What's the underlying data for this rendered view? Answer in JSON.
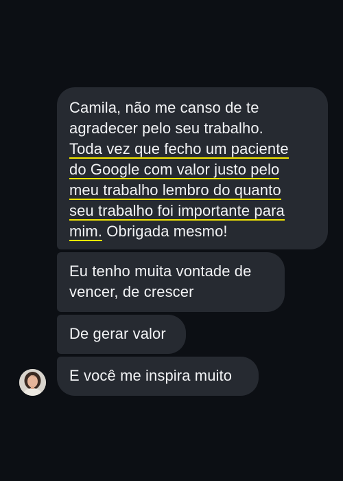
{
  "conversation": {
    "messages": [
      {
        "lines": [
          "Camila, não me canso de te",
          "agradecer pelo seu trabalho.",
          "Toda vez que fecho um paciente",
          "do Google com valor justo pelo",
          "meu trabalho lembro do quanto",
          "seu trabalho foi importante para",
          "mim.",
          " Obrigada mesmo!"
        ]
      },
      {
        "lines": [
          "Eu tenho muita vontade de",
          "vencer, de crescer"
        ]
      },
      {
        "lines": [
          "De gerar valor"
        ]
      },
      {
        "lines": [
          "E você me inspira muito"
        ]
      }
    ],
    "avatar": {
      "icon": "user-avatar-photo"
    },
    "colors": {
      "background": "#0c0f14",
      "bubble": "#262a31",
      "text": "#f2f3f5",
      "highlight_underline": "#f5e800"
    }
  }
}
